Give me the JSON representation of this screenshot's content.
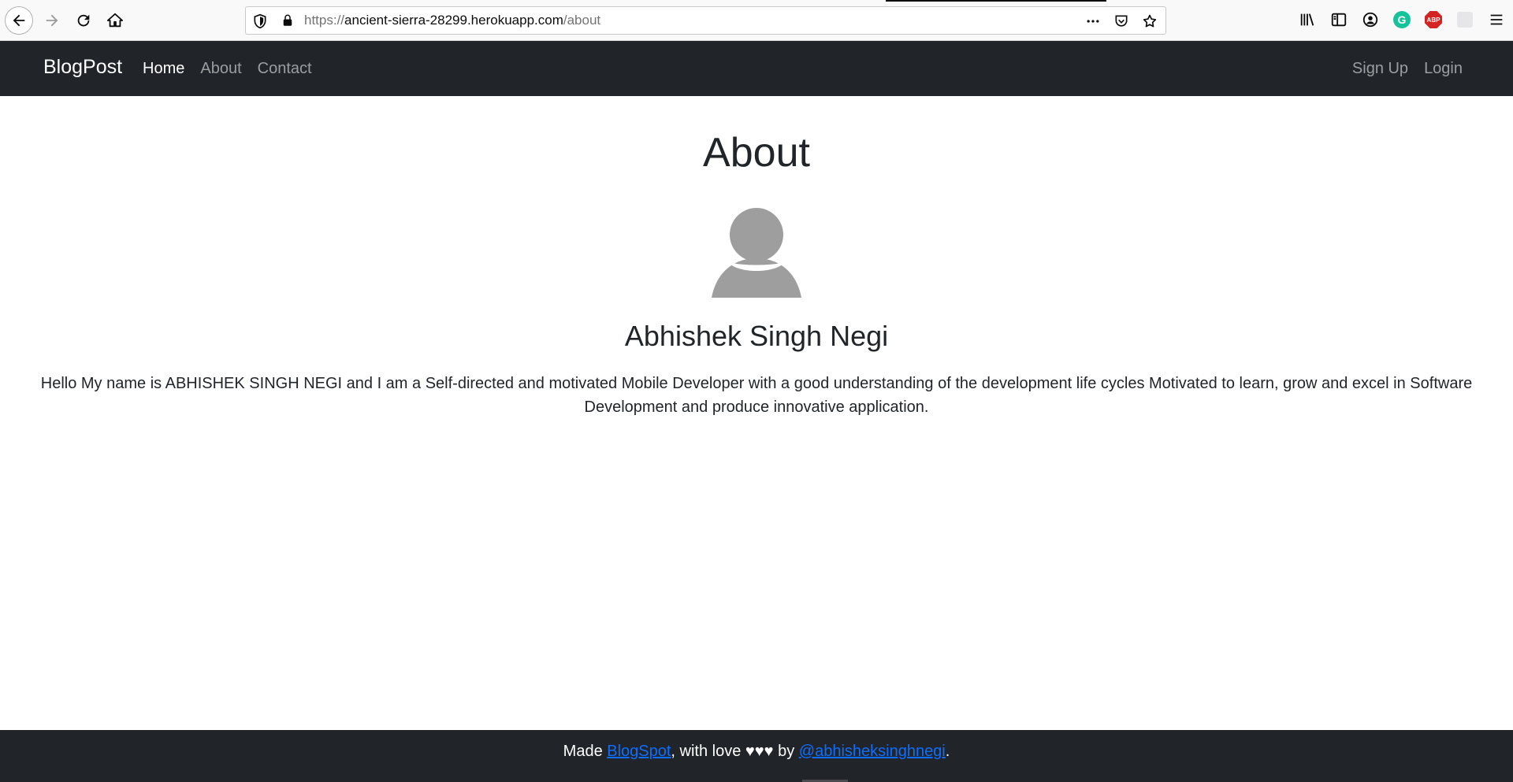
{
  "browser": {
    "url_host": "ancient-sierra-28299.herokuapp.com",
    "url_prefix": "https://",
    "url_path": "/about",
    "icons": [
      "back-icon",
      "forward-icon",
      "reload-icon",
      "home-icon",
      "shield-icon",
      "lock-icon",
      "more-icon",
      "pocket-icon",
      "bookmark-star-icon",
      "library-icon",
      "sidebar-icon",
      "account-icon",
      "grammarly-icon",
      "adblock-icon",
      "extension-icon",
      "menu-icon"
    ],
    "grammarly_label": "G",
    "abp_label": "ABP"
  },
  "navbar": {
    "brand": "BlogPost",
    "links": [
      {
        "label": "Home"
      },
      {
        "label": "About"
      },
      {
        "label": "Contact"
      }
    ],
    "right_links": [
      {
        "label": "Sign Up"
      },
      {
        "label": "Login"
      }
    ]
  },
  "main": {
    "title": "About",
    "name": "Abhishek Singh Negi",
    "bio": "Hello My name is ABHISHEK SINGH NEGI and I am a Self-directed and motivated Mobile Developer with a good understanding of the development life cycles Motivated to learn, grow and excel in Software Development and produce innovative application."
  },
  "footer": {
    "prefix": "Made ",
    "link1": "BlogSpot",
    "middle": ", with love ♥♥♥ by ",
    "link2": "@abhisheksinghnegi",
    "suffix": "."
  },
  "colors": {
    "navbar_bg": "#212529",
    "link_blue": "#0d6efd",
    "avatar_gray": "#9e9e9e"
  }
}
